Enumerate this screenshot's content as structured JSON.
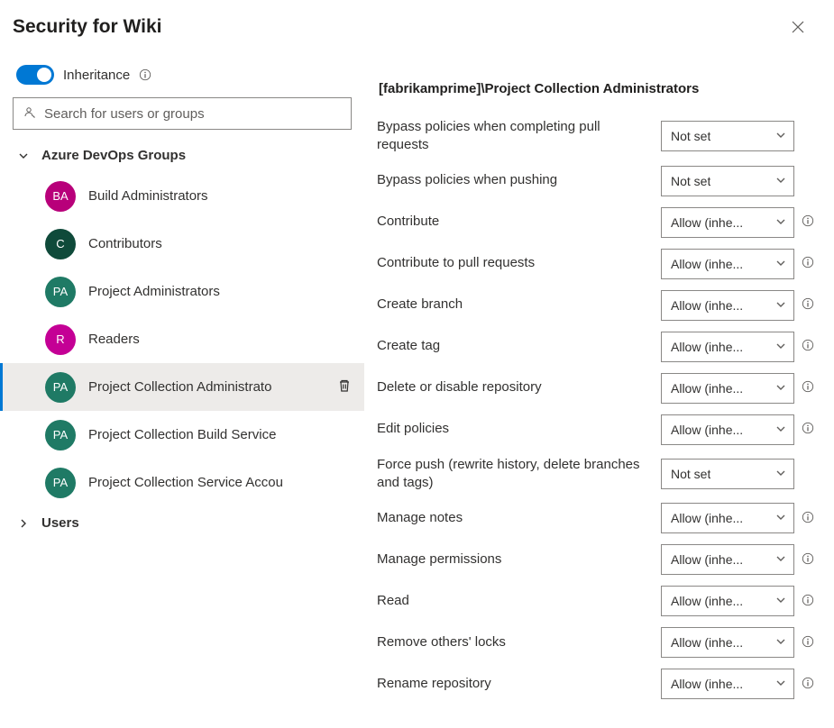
{
  "dialog": {
    "title": "Security for Wiki"
  },
  "left": {
    "inheritance_label": "Inheritance",
    "search_placeholder": "Search for users or groups",
    "groups_header": "Azure DevOps Groups",
    "users_header": "Users",
    "groups": [
      {
        "abbr": "BA",
        "name": "Build Administrators",
        "color": "#b8007a",
        "selected": false
      },
      {
        "abbr": "C",
        "name": "Contributors",
        "color": "#0f4a3a",
        "selected": false
      },
      {
        "abbr": "PA",
        "name": "Project Administrators",
        "color": "#1f7a65",
        "selected": false
      },
      {
        "abbr": "R",
        "name": "Readers",
        "color": "#c40095",
        "selected": false
      },
      {
        "abbr": "PA",
        "name": "Project Collection Administrato",
        "color": "#1f7a65",
        "selected": true
      },
      {
        "abbr": "PA",
        "name": "Project Collection Build Service",
        "color": "#1f7a65",
        "selected": false
      },
      {
        "abbr": "PA",
        "name": "Project Collection Service Accou",
        "color": "#1f7a65",
        "selected": false
      }
    ]
  },
  "right": {
    "title": "[fabrikamprime]\\Project Collection Administrators",
    "permissions": [
      {
        "label": "Bypass policies when completing pull requests",
        "value": "Not set",
        "info": false
      },
      {
        "label": "Bypass policies when pushing",
        "value": "Not set",
        "info": false
      },
      {
        "label": "Contribute",
        "value": "Allow (inhe...",
        "info": true
      },
      {
        "label": "Contribute to pull requests",
        "value": "Allow (inhe...",
        "info": true
      },
      {
        "label": "Create branch",
        "value": "Allow (inhe...",
        "info": true
      },
      {
        "label": "Create tag",
        "value": "Allow (inhe...",
        "info": true
      },
      {
        "label": "Delete or disable repository",
        "value": "Allow (inhe...",
        "info": true
      },
      {
        "label": "Edit policies",
        "value": "Allow (inhe...",
        "info": true
      },
      {
        "label": "Force push (rewrite history, delete branches and tags)",
        "value": "Not set",
        "info": false
      },
      {
        "label": "Manage notes",
        "value": "Allow (inhe...",
        "info": true
      },
      {
        "label": "Manage permissions",
        "value": "Allow (inhe...",
        "info": true
      },
      {
        "label": "Read",
        "value": "Allow (inhe...",
        "info": true
      },
      {
        "label": "Remove others' locks",
        "value": "Allow (inhe...",
        "info": true
      },
      {
        "label": "Rename repository",
        "value": "Allow (inhe...",
        "info": true
      }
    ]
  }
}
